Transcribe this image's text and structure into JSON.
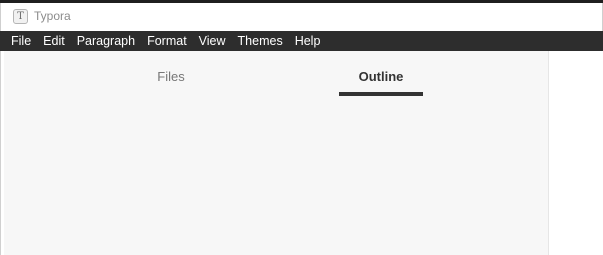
{
  "window": {
    "title": "Typora",
    "app_icon_glyph": "T"
  },
  "menubar": {
    "items": [
      "File",
      "Edit",
      "Paragraph",
      "Format",
      "View",
      "Themes",
      "Help"
    ]
  },
  "sidebar": {
    "tabs": [
      {
        "label": "Files",
        "active": false
      },
      {
        "label": "Outline",
        "active": true
      }
    ]
  },
  "colors": {
    "menubar_bg": "#2d2d2d",
    "sidebar_bg": "#f7f7f7",
    "active_tab": "#333333",
    "inactive_tab": "#777777"
  }
}
